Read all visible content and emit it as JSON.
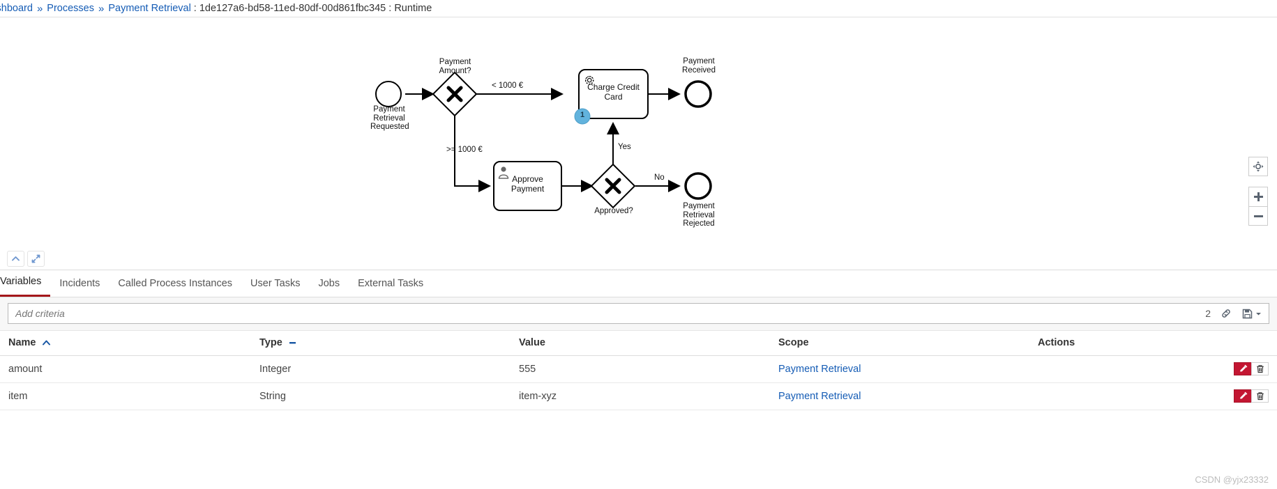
{
  "breadcrumb": {
    "dashboard": "Dashboard",
    "processes": "Processes",
    "process_name": "Payment Retrieval",
    "separator": "»",
    "colon": ":",
    "instance_id": "1de127a6-bd58-11ed-80df-00d861fbc345 : Runtime"
  },
  "diagram": {
    "start_event_label": "Payment\nRetrieval\nRequested",
    "start_event_l1": "Payment",
    "start_event_l2": "Retrieval",
    "start_event_l3": "Requested",
    "gateway1_label_l1": "Payment",
    "gateway1_label_l2": "Amount?",
    "flow_lt_label": "< 1000 €",
    "flow_gte_label": ">= 1000 €",
    "task_charge_l1": "Charge Credit",
    "task_charge_l2": "Card",
    "task_approve_l1": "Approve",
    "task_approve_l2": "Payment",
    "badge_count": "1",
    "end_received_l1": "Payment",
    "end_received_l2": "Received",
    "gateway2_label": "Approved?",
    "flow_yes_label": "Yes",
    "flow_no_label": "No",
    "end_rejected_l1": "Payment",
    "end_rejected_l2": "Retrieval",
    "end_rejected_l3": "Rejected",
    "badge_color": "#62b3dd",
    "zoom_controls": {
      "reset_icon": "crosshair-icon",
      "zoom_in_icon": "plus-icon",
      "zoom_out_icon": "minus-icon"
    },
    "collapse_icon": "chevron-up-icon",
    "expand_icon": "expand-diagonal-icon"
  },
  "tabs": [
    {
      "label": "Variables",
      "active": true
    },
    {
      "label": "Incidents",
      "active": false
    },
    {
      "label": "Called Process Instances",
      "active": false
    },
    {
      "label": "User Tasks",
      "active": false
    },
    {
      "label": "Jobs",
      "active": false
    },
    {
      "label": "External Tasks",
      "active": false
    }
  ],
  "criteria": {
    "placeholder": "Add criteria",
    "value": "",
    "count": "2",
    "link_icon": "link-chain-icon",
    "save_icon": "floppy-disk-icon",
    "caret_icon": "caret-down-icon"
  },
  "table": {
    "headers": {
      "name": "Name",
      "type": "Type",
      "value": "Value",
      "scope": "Scope",
      "actions": "Actions"
    },
    "name_sort_icon": "chevron-up-icon",
    "type_sort_icon": "minus-icon",
    "rows": [
      {
        "name": "amount",
        "type": "Integer",
        "value": "555",
        "scope": "Payment Retrieval"
      },
      {
        "name": "item",
        "type": "String",
        "value": "item-xyz",
        "scope": "Payment Retrieval"
      }
    ],
    "edit_icon": "pencil-icon",
    "delete_icon": "trash-icon"
  },
  "watermark": "CSDN @yjx23332",
  "colors": {
    "accent_red": "#a4161a",
    "link_blue": "#155cb5",
    "edit_red": "#c31632",
    "badge_blue": "#62b3dd"
  }
}
